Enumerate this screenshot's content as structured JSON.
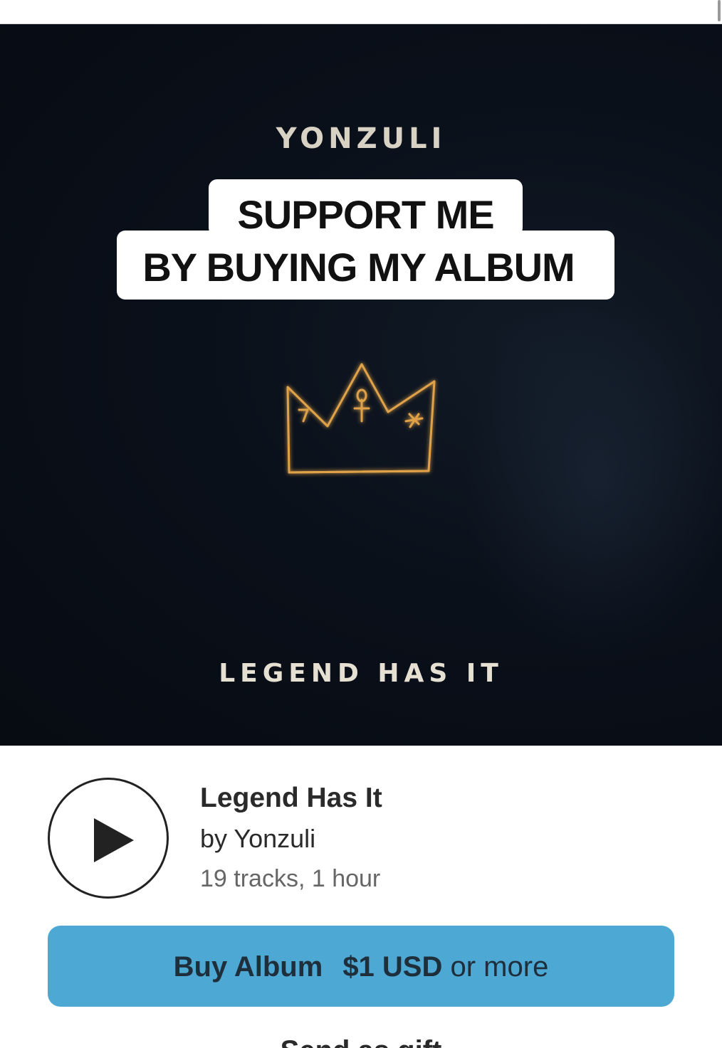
{
  "cover": {
    "artist_text": "YONZULI",
    "title_text": "LEGEND HAS IT",
    "crown_color": "#e0a24a",
    "background_color": "#070b12"
  },
  "caption": {
    "line1": "SUPPORT ME",
    "line2": "BY BUYING MY ALBUM"
  },
  "album": {
    "title": "Legend Has It",
    "by": "by Yonzuli",
    "meta": "19 tracks, 1 hour"
  },
  "buy": {
    "label": "Buy Album",
    "price": "$1 USD",
    "suffix": "or more",
    "color": "#4ea8d4"
  },
  "gift": {
    "label": "Send as gift"
  },
  "icons": {
    "play": "play-icon",
    "crown": "crown-icon"
  }
}
